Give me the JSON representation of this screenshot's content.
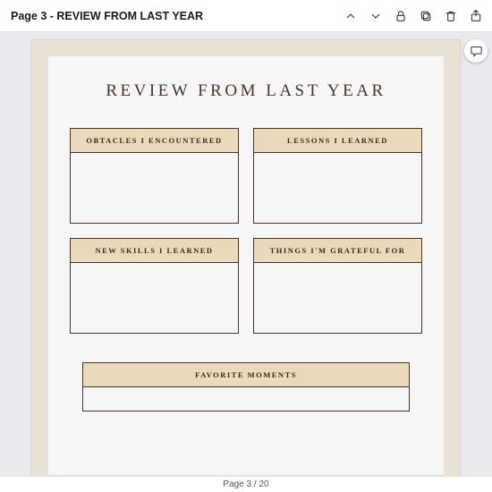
{
  "toolbar": {
    "title": "Page 3 - REVIEW FROM LAST YEAR"
  },
  "document": {
    "heading": "REVIEW FROM LAST YEAR",
    "boxes": {
      "obstacles": "OBTACLES I ENCOUNTERED",
      "lessons": "LESSONS I LEARNED",
      "skills": "NEW SKILLS I LEARNED",
      "grateful": "THINGS I'M GRATEFUL  FOR",
      "favorite": "FAVORITE MOMENTS"
    }
  },
  "footer": {
    "pager": "Page 3 / 20"
  }
}
